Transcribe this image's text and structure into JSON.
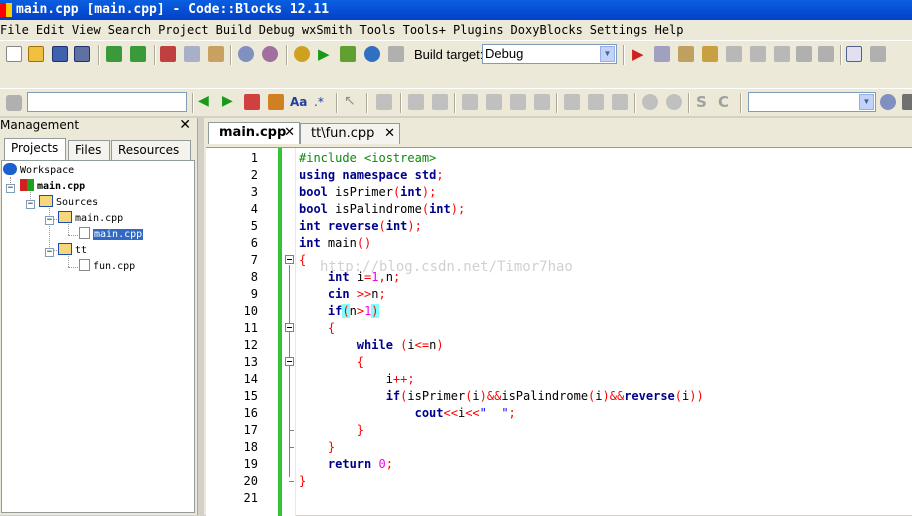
{
  "window": {
    "title": "main.cpp [main.cpp] - Code::Blocks 12.11"
  },
  "menu": [
    "File",
    "Edit",
    "View",
    "Search",
    "Project",
    "Build",
    "Debug",
    "wxSmith",
    "Tools",
    "Tools+",
    "Plugins",
    "DoxyBlocks",
    "Settings",
    "Help"
  ],
  "toolbar": {
    "build_target_label": "Build target:",
    "build_target_value": "Debug",
    "search_value": "",
    "combo2_value": ""
  },
  "management": {
    "title": "Management",
    "tabs": [
      "Projects",
      "Files",
      "Resources"
    ],
    "tree": {
      "workspace": "Workspace",
      "project": "main.cpp",
      "sources": "Sources",
      "folder_main": "main.cpp",
      "file_main": "main.cpp",
      "folder_tt": "tt",
      "file_fun": "fun.cpp"
    }
  },
  "editor": {
    "tabs": [
      {
        "label": "main.cpp",
        "active": true
      },
      {
        "label": "tt\\fun.cpp",
        "active": false
      }
    ],
    "line_numbers": [
      "1",
      "2",
      "3",
      "4",
      "5",
      "6",
      "7",
      "8",
      "9",
      "10",
      "11",
      "12",
      "13",
      "14",
      "15",
      "16",
      "17",
      "18",
      "19",
      "20",
      "21"
    ],
    "watermark": "http://blog.csdn.net/Timor7hao"
  },
  "colors": {
    "title_bar": "#0a5fe0",
    "change_bar": "#36c236",
    "keyword": "#00008b",
    "preprocessor": "#0a8a0a",
    "number": "#f000f0"
  }
}
